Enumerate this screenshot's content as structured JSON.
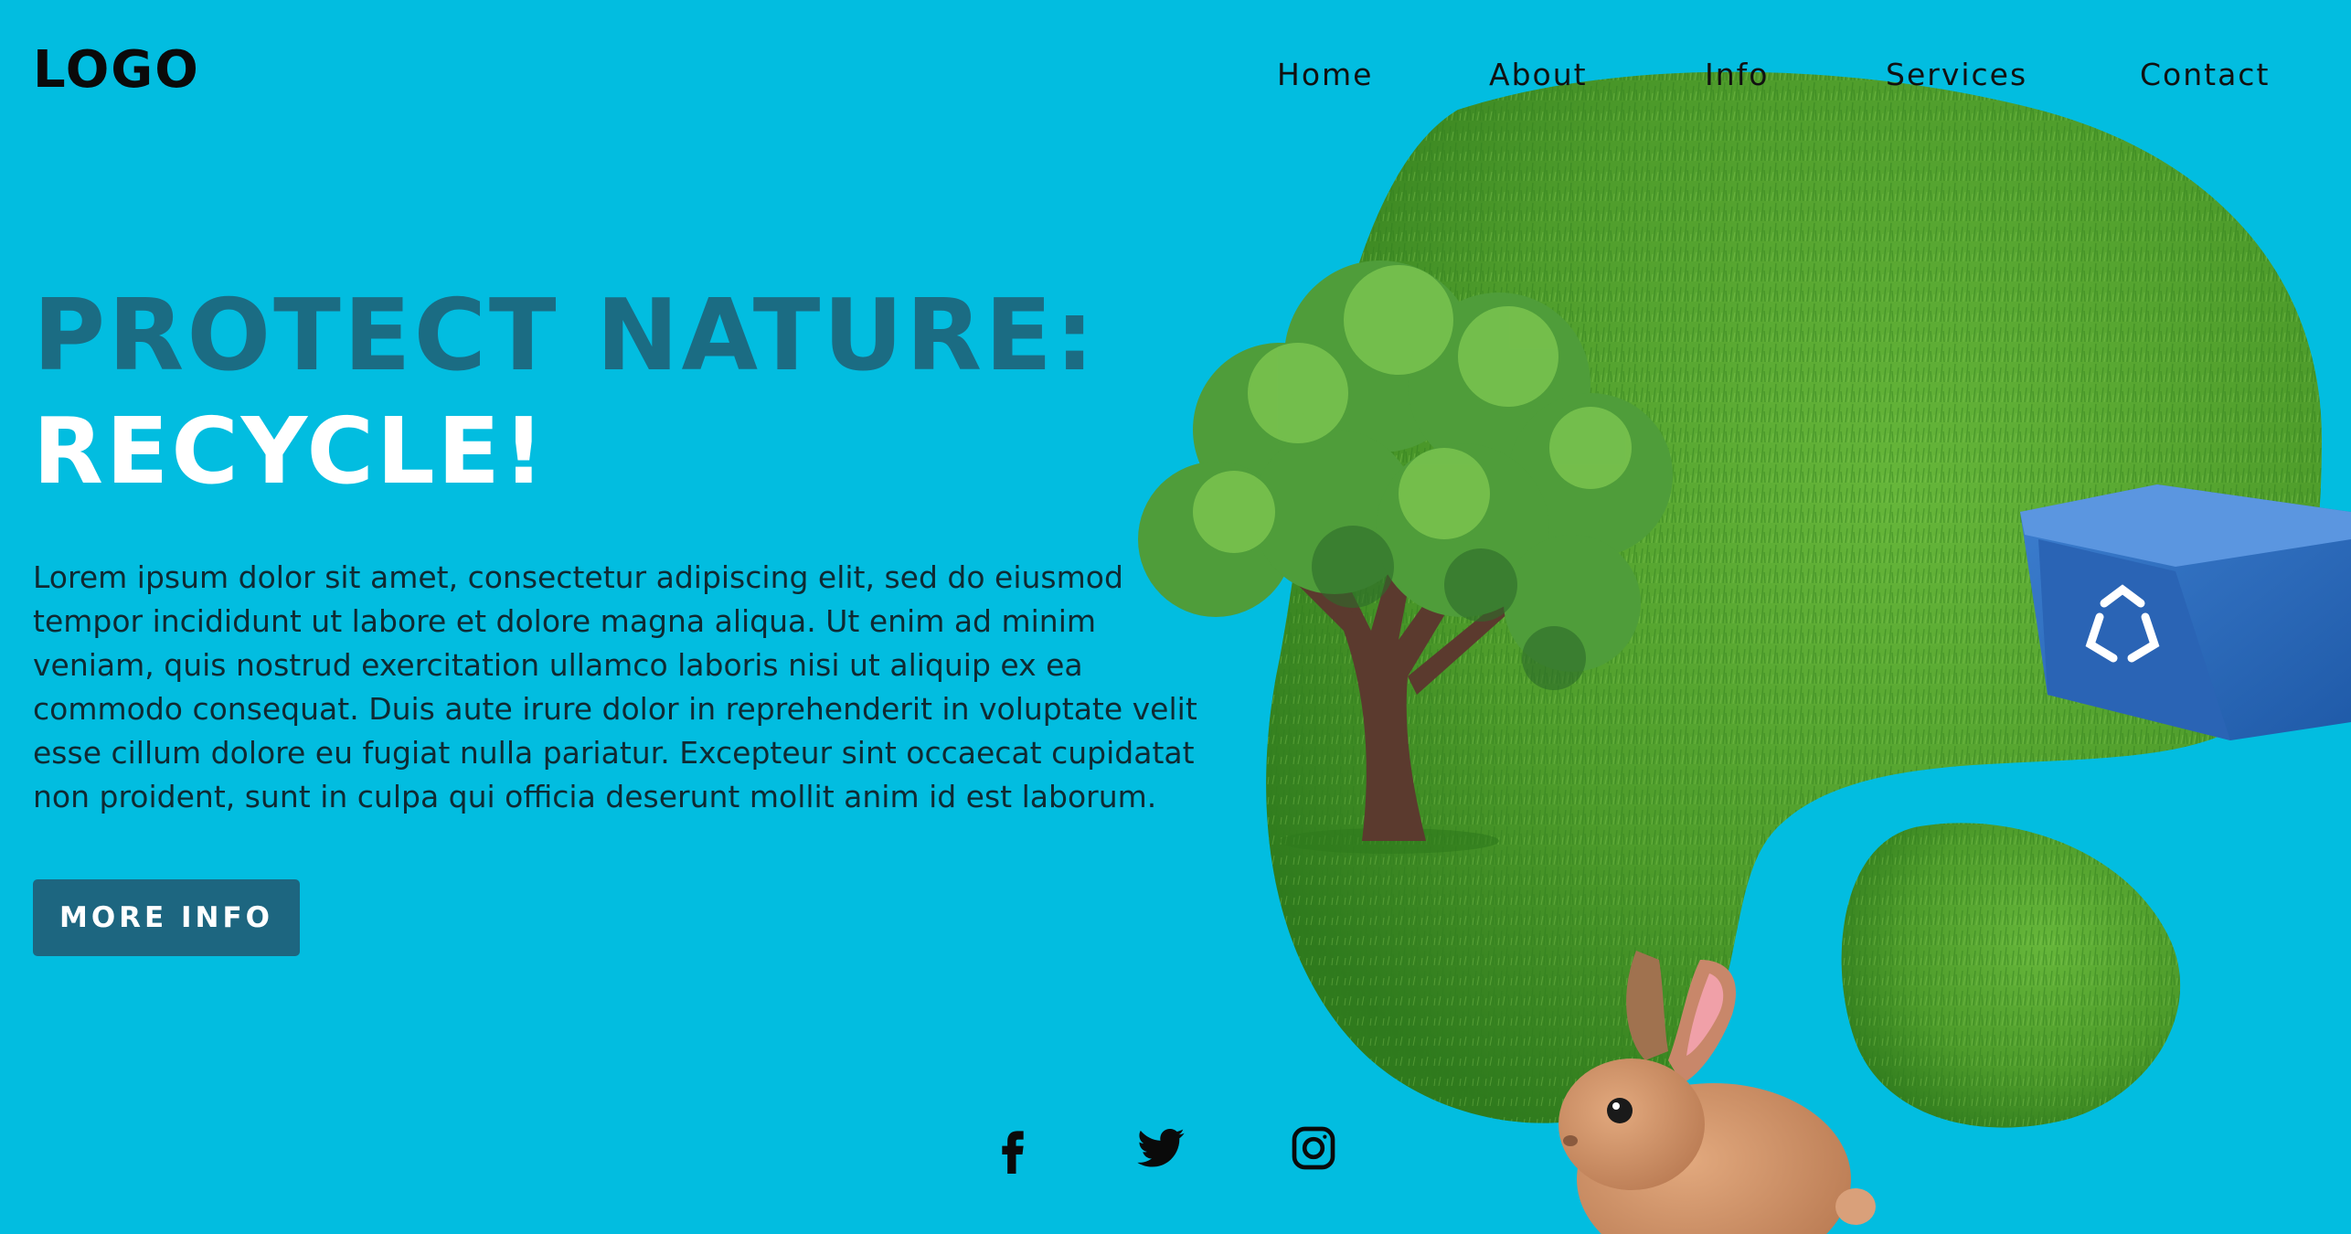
{
  "header": {
    "logo": "LOGO",
    "nav": [
      "Home",
      "About",
      "Info",
      "Services",
      "Contact"
    ]
  },
  "hero": {
    "title_line1": "PROTECT NATURE:",
    "title_line2": "RECYCLE!",
    "body": "Lorem ipsum dolor sit amet, consectetur adipiscing elit, sed do eiusmod tempor incididunt ut labore et dolore magna aliqua. Ut enim ad minim veniam, quis nostrud exercitation ullamco laboris nisi ut aliquip ex ea commodo consequat. Duis aute irure dolor in reprehenderit in voluptate velit esse cillum dolore eu fugiat nulla pariatur. Excepteur sint occaecat cupidatat non proident, sunt in culpa qui officia deserunt mollit anim id est laborum.",
    "button": "MORE INFO"
  },
  "social": [
    "facebook-icon",
    "twitter-icon",
    "instagram-icon"
  ],
  "colors": {
    "background": "#02bde0",
    "title_accent": "#1b6c83",
    "button": "#1d6680",
    "grass": "#4f9a2c"
  }
}
